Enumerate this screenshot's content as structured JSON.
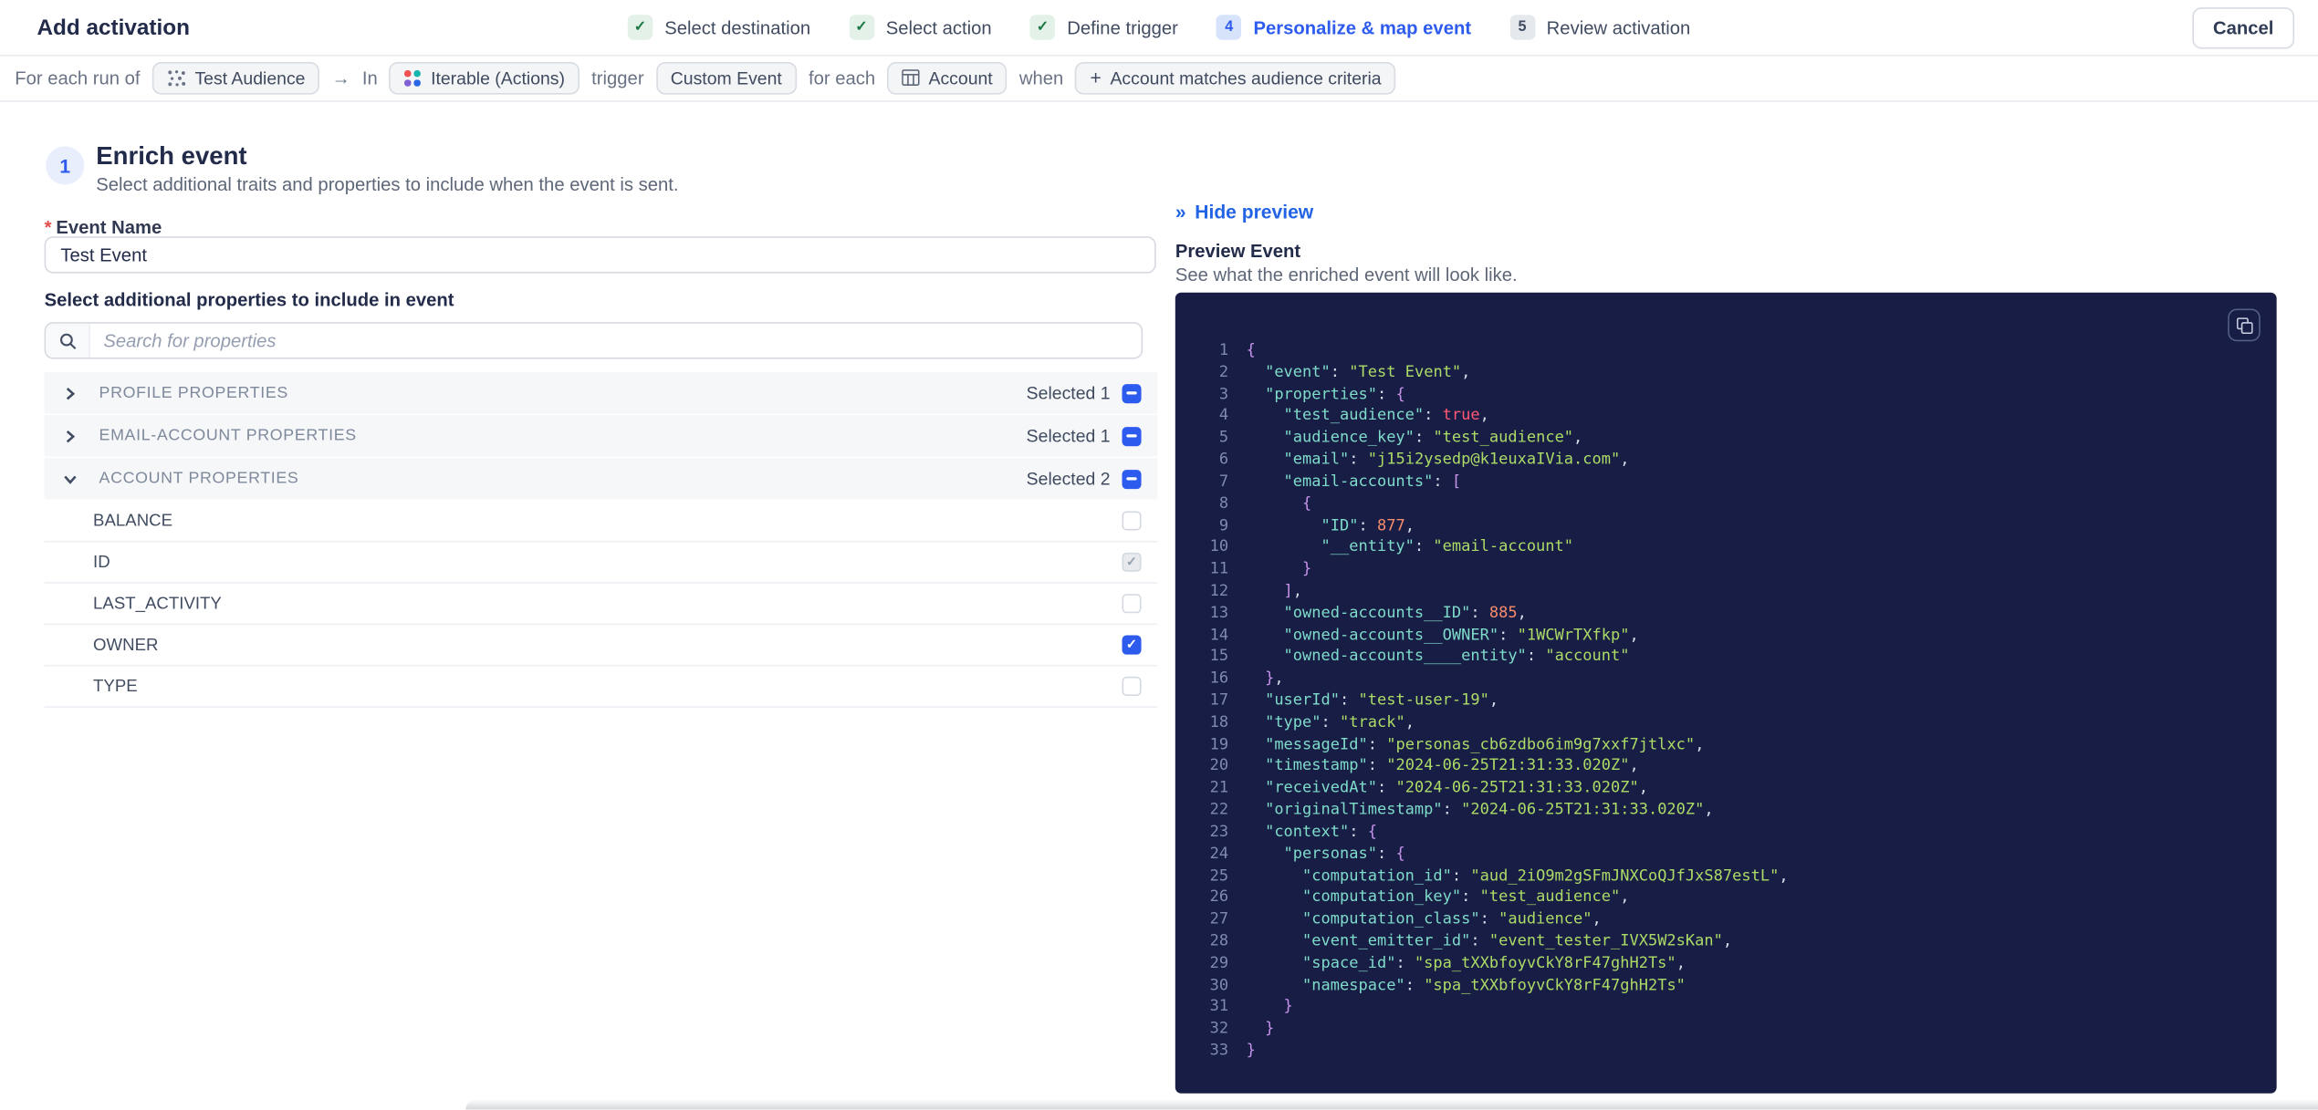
{
  "colors": {
    "accent_blue": "#2d5bee",
    "link_blue": "#2264e5",
    "success_green": "#1d7a45",
    "required_red": "#e14b4b",
    "code_bg": "#171d44",
    "code_key": "#7fdbca",
    "code_string": "#addb67",
    "code_number": "#f78c6c",
    "code_boolean": "#ff5874",
    "code_brace": "#c792ea"
  },
  "glyphs": {
    "check": "✓",
    "plus": "+",
    "arrow": "→",
    "collapse": "»"
  },
  "header": {
    "title": "Add activation",
    "cancel_label": "Cancel",
    "steps": [
      {
        "label": "Select destination",
        "status": "done"
      },
      {
        "label": "Select action",
        "status": "done"
      },
      {
        "label": "Define trigger",
        "status": "done"
      },
      {
        "label": "Personalize & map event",
        "status": "current",
        "number": "4"
      },
      {
        "label": "Review activation",
        "status": "upcoming",
        "number": "5"
      }
    ]
  },
  "context_bar": {
    "prefix": "For each run of",
    "audience_chip": "Test Audience",
    "arrow": "→",
    "in_label": "In",
    "destination_chip": "Iterable (Actions)",
    "trigger_label": "trigger",
    "event_chip": "Custom Event",
    "for_each_label": "for each",
    "entity_chip": "Account",
    "when_label": "when",
    "criteria_chip": "Account matches audience criteria"
  },
  "enrich": {
    "step_number": "1",
    "title": "Enrich event",
    "subtitle": "Select additional traits and properties to include when the event is sent.",
    "required_mark": "*",
    "event_name_label": "Event Name",
    "event_name_value": "Test Event",
    "properties_label": "Select additional properties to include in event",
    "search_placeholder": "Search for properties",
    "groups": [
      {
        "label": "PROFILE PROPERTIES",
        "selected_text": "Selected 1",
        "expanded": false,
        "checkbox_state": "indeterminate"
      },
      {
        "label": "EMAIL-ACCOUNT PROPERTIES",
        "selected_text": "Selected 1",
        "expanded": false,
        "checkbox_state": "indeterminate"
      },
      {
        "label": "ACCOUNT PROPERTIES",
        "selected_text": "Selected 2",
        "expanded": true,
        "checkbox_state": "indeterminate",
        "items": [
          {
            "label": "BALANCE",
            "checkbox_state": "unchecked"
          },
          {
            "label": "ID",
            "checkbox_state": "checked-disabled"
          },
          {
            "label": "LAST_ACTIVITY",
            "checkbox_state": "unchecked"
          },
          {
            "label": "OWNER",
            "checkbox_state": "checked"
          },
          {
            "label": "TYPE",
            "checkbox_state": "unchecked"
          }
        ]
      }
    ]
  },
  "preview": {
    "collapse_label": "Hide preview",
    "title": "Preview Event",
    "subtitle": "See what the enriched event will look like.",
    "copy_icon": "copy-icon",
    "code": {
      "lines": [
        {
          "n": 1,
          "tk": [
            [
              "brc",
              "{"
            ]
          ]
        },
        {
          "n": 2,
          "tk": [
            [
              "pln",
              "  "
            ],
            [
              "key",
              "\"event\""
            ],
            [
              "pun",
              ": "
            ],
            [
              "str",
              "\"Test Event\""
            ],
            [
              "pun",
              ","
            ]
          ]
        },
        {
          "n": 3,
          "tk": [
            [
              "pln",
              "  "
            ],
            [
              "key",
              "\"properties\""
            ],
            [
              "pun",
              ": "
            ],
            [
              "brc",
              "{"
            ]
          ]
        },
        {
          "n": 4,
          "tk": [
            [
              "pln",
              "    "
            ],
            [
              "key",
              "\"test_audience\""
            ],
            [
              "pun",
              ": "
            ],
            [
              "boo",
              "true"
            ],
            [
              "pun",
              ","
            ]
          ]
        },
        {
          "n": 5,
          "tk": [
            [
              "pln",
              "    "
            ],
            [
              "key",
              "\"audience_key\""
            ],
            [
              "pun",
              ": "
            ],
            [
              "str",
              "\"test_audience\""
            ],
            [
              "pun",
              ","
            ]
          ]
        },
        {
          "n": 6,
          "tk": [
            [
              "pln",
              "    "
            ],
            [
              "key",
              "\"email\""
            ],
            [
              "pun",
              ": "
            ],
            [
              "str",
              "\"j15i2ysedp@k1euxaIVia.com\""
            ],
            [
              "pun",
              ","
            ]
          ]
        },
        {
          "n": 7,
          "tk": [
            [
              "pln",
              "    "
            ],
            [
              "key",
              "\"email-accounts\""
            ],
            [
              "pun",
              ": "
            ],
            [
              "brc",
              "["
            ]
          ]
        },
        {
          "n": 8,
          "tk": [
            [
              "pln",
              "      "
            ],
            [
              "brc",
              "{"
            ]
          ]
        },
        {
          "n": 9,
          "tk": [
            [
              "pln",
              "        "
            ],
            [
              "key",
              "\"ID\""
            ],
            [
              "pun",
              ": "
            ],
            [
              "num",
              "877"
            ],
            [
              "pun",
              ","
            ]
          ]
        },
        {
          "n": 10,
          "tk": [
            [
              "pln",
              "        "
            ],
            [
              "key",
              "\"__entity\""
            ],
            [
              "pun",
              ": "
            ],
            [
              "str",
              "\"email-account\""
            ]
          ]
        },
        {
          "n": 11,
          "tk": [
            [
              "pln",
              "      "
            ],
            [
              "brc",
              "}"
            ]
          ]
        },
        {
          "n": 12,
          "tk": [
            [
              "pln",
              "    "
            ],
            [
              "brc",
              "]"
            ],
            [
              "pun",
              ","
            ]
          ]
        },
        {
          "n": 13,
          "tk": [
            [
              "pln",
              "    "
            ],
            [
              "key",
              "\"owned-accounts__ID\""
            ],
            [
              "pun",
              ": "
            ],
            [
              "num",
              "885"
            ],
            [
              "pun",
              ","
            ]
          ]
        },
        {
          "n": 14,
          "tk": [
            [
              "pln",
              "    "
            ],
            [
              "key",
              "\"owned-accounts__OWNER\""
            ],
            [
              "pun",
              ": "
            ],
            [
              "str",
              "\"1WCWrTXfkp\""
            ],
            [
              "pun",
              ","
            ]
          ]
        },
        {
          "n": 15,
          "tk": [
            [
              "pln",
              "    "
            ],
            [
              "key",
              "\"owned-accounts____entity\""
            ],
            [
              "pun",
              ": "
            ],
            [
              "str",
              "\"account\""
            ]
          ]
        },
        {
          "n": 16,
          "tk": [
            [
              "pln",
              "  "
            ],
            [
              "brc",
              "}"
            ],
            [
              "pun",
              ","
            ]
          ]
        },
        {
          "n": 17,
          "tk": [
            [
              "pln",
              "  "
            ],
            [
              "key",
              "\"userId\""
            ],
            [
              "pun",
              ": "
            ],
            [
              "str",
              "\"test-user-19\""
            ],
            [
              "pun",
              ","
            ]
          ]
        },
        {
          "n": 18,
          "tk": [
            [
              "pln",
              "  "
            ],
            [
              "key",
              "\"type\""
            ],
            [
              "pun",
              ": "
            ],
            [
              "str",
              "\"track\""
            ],
            [
              "pun",
              ","
            ]
          ]
        },
        {
          "n": 19,
          "tk": [
            [
              "pln",
              "  "
            ],
            [
              "key",
              "\"messageId\""
            ],
            [
              "pun",
              ": "
            ],
            [
              "str",
              "\"personas_cb6zdbo6im9g7xxf7jtlxc\""
            ],
            [
              "pun",
              ","
            ]
          ]
        },
        {
          "n": 20,
          "tk": [
            [
              "pln",
              "  "
            ],
            [
              "key",
              "\"timestamp\""
            ],
            [
              "pun",
              ": "
            ],
            [
              "str",
              "\"2024-06-25T21:31:33.020Z\""
            ],
            [
              "pun",
              ","
            ]
          ]
        },
        {
          "n": 21,
          "tk": [
            [
              "pln",
              "  "
            ],
            [
              "key",
              "\"receivedAt\""
            ],
            [
              "pun",
              ": "
            ],
            [
              "str",
              "\"2024-06-25T21:31:33.020Z\""
            ],
            [
              "pun",
              ","
            ]
          ]
        },
        {
          "n": 22,
          "tk": [
            [
              "pln",
              "  "
            ],
            [
              "key",
              "\"originalTimestamp\""
            ],
            [
              "pun",
              ": "
            ],
            [
              "str",
              "\"2024-06-25T21:31:33.020Z\""
            ],
            [
              "pun",
              ","
            ]
          ]
        },
        {
          "n": 23,
          "tk": [
            [
              "pln",
              "  "
            ],
            [
              "key",
              "\"context\""
            ],
            [
              "pun",
              ": "
            ],
            [
              "brc",
              "{"
            ]
          ]
        },
        {
          "n": 24,
          "tk": [
            [
              "pln",
              "    "
            ],
            [
              "key",
              "\"personas\""
            ],
            [
              "pun",
              ": "
            ],
            [
              "brc",
              "{"
            ]
          ]
        },
        {
          "n": 25,
          "tk": [
            [
              "pln",
              "      "
            ],
            [
              "key",
              "\"computation_id\""
            ],
            [
              "pun",
              ": "
            ],
            [
              "str",
              "\"aud_2iO9m2gSFmJNXCoQJfJxS87estL\""
            ],
            [
              "pun",
              ","
            ]
          ]
        },
        {
          "n": 26,
          "tk": [
            [
              "pln",
              "      "
            ],
            [
              "key",
              "\"computation_key\""
            ],
            [
              "pun",
              ": "
            ],
            [
              "str",
              "\"test_audience\""
            ],
            [
              "pun",
              ","
            ]
          ]
        },
        {
          "n": 27,
          "tk": [
            [
              "pln",
              "      "
            ],
            [
              "key",
              "\"computation_class\""
            ],
            [
              "pun",
              ": "
            ],
            [
              "str",
              "\"audience\""
            ],
            [
              "pun",
              ","
            ]
          ]
        },
        {
          "n": 28,
          "tk": [
            [
              "pln",
              "      "
            ],
            [
              "key",
              "\"event_emitter_id\""
            ],
            [
              "pun",
              ": "
            ],
            [
              "str",
              "\"event_tester_IVX5W2sKan\""
            ],
            [
              "pun",
              ","
            ]
          ]
        },
        {
          "n": 29,
          "tk": [
            [
              "pln",
              "      "
            ],
            [
              "key",
              "\"space_id\""
            ],
            [
              "pun",
              ": "
            ],
            [
              "str",
              "\"spa_tXXbfoyvCkY8rF47ghH2Ts\""
            ],
            [
              "pun",
              ","
            ]
          ]
        },
        {
          "n": 30,
          "tk": [
            [
              "pln",
              "      "
            ],
            [
              "key",
              "\"namespace\""
            ],
            [
              "pun",
              ": "
            ],
            [
              "str",
              "\"spa_tXXbfoyvCkY8rF47ghH2Ts\""
            ]
          ]
        },
        {
          "n": 31,
          "tk": [
            [
              "pln",
              "    "
            ],
            [
              "brc",
              "}"
            ]
          ]
        },
        {
          "n": 32,
          "tk": [
            [
              "pln",
              "  "
            ],
            [
              "brc",
              "}"
            ]
          ]
        },
        {
          "n": 33,
          "tk": [
            [
              "brc",
              "}"
            ]
          ]
        }
      ]
    }
  }
}
